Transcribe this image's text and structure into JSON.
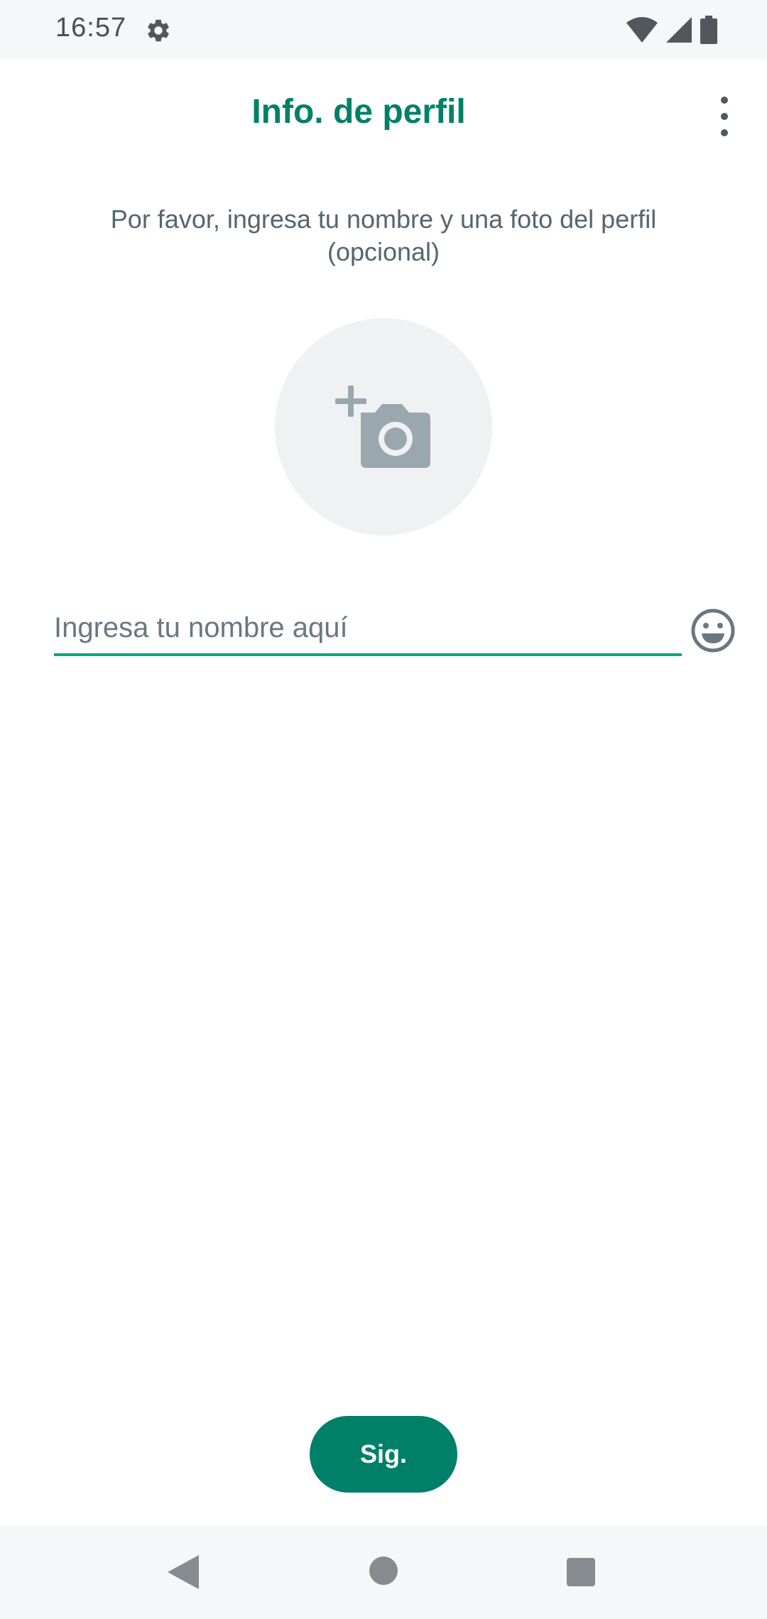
{
  "status_bar": {
    "time": "16:57",
    "icons": [
      "settings-gear-icon",
      "wifi-icon",
      "cell-signal-icon",
      "battery-icon"
    ]
  },
  "app_bar": {
    "title": "Info. de perfil",
    "menu_icon": "more-vert-icon"
  },
  "main": {
    "instructions": "Por favor, ingresa tu nombre y una foto del perfil (opcional)",
    "photo_icon": "add-photo-camera-icon",
    "name_input": {
      "value": "",
      "placeholder": "Ingresa tu nombre aquí"
    },
    "emoji_icon": "emoji-smile-icon",
    "next_label": "Sig."
  },
  "nav_bar": {
    "icons": [
      "back-icon",
      "home-icon",
      "recents-icon"
    ]
  },
  "colors": {
    "accent": "#008069",
    "input_underline": "#00a884",
    "text_secondary": "#54656f",
    "icon_gray": "#9aa7af",
    "system_bar": "#f6f7f9"
  }
}
